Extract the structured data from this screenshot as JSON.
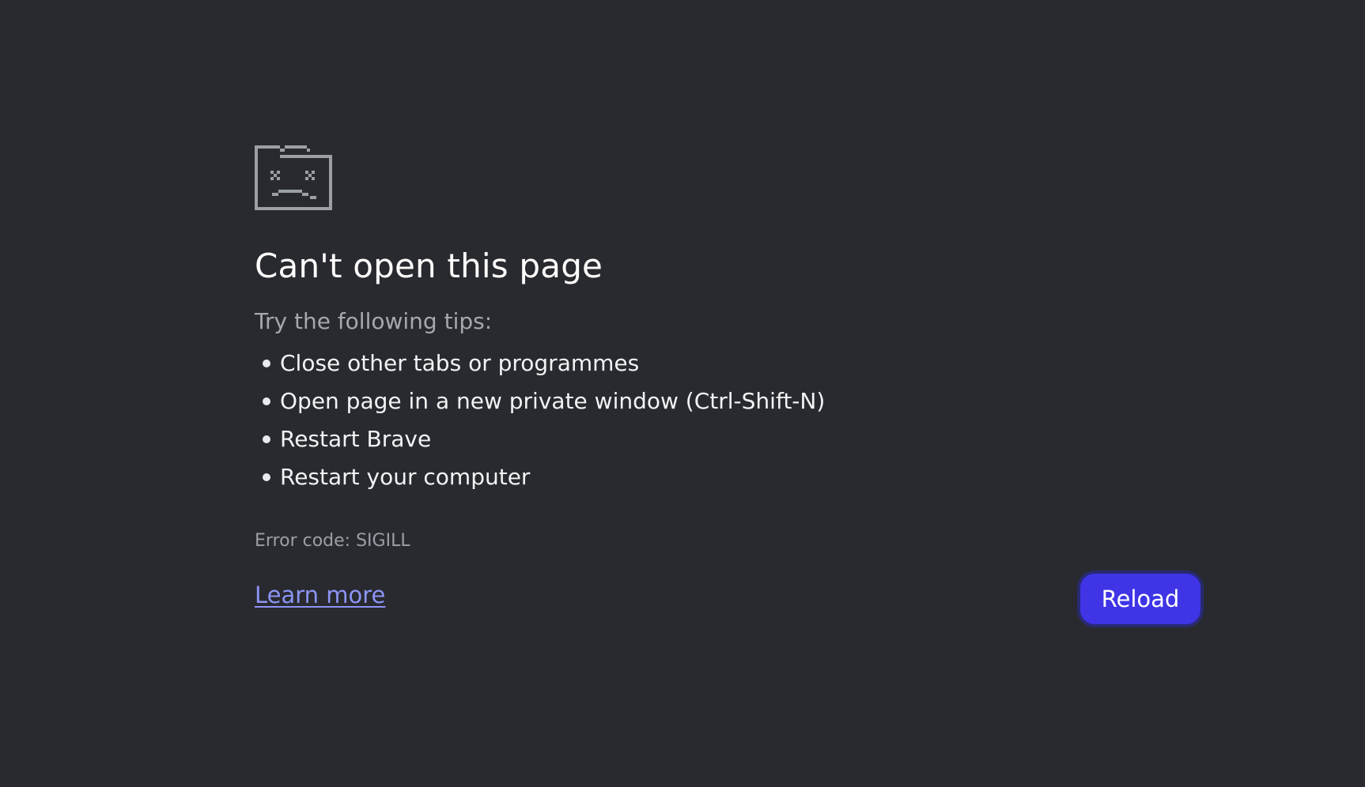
{
  "page": {
    "title": "Can't open this page",
    "intro": "Try the following tips:",
    "tips": [
      "Close other tabs or programmes",
      "Open page in a new private window (Ctrl-Shift-N)",
      "Restart Brave",
      "Restart your computer"
    ],
    "error_code": "Error code: SIGILL",
    "learn_more": "Learn more",
    "reload": "Reload",
    "icon": "sad-folder-icon"
  },
  "colors": {
    "background": "#292a2f",
    "link": "#8c94f5",
    "button": "#3f34e6"
  }
}
